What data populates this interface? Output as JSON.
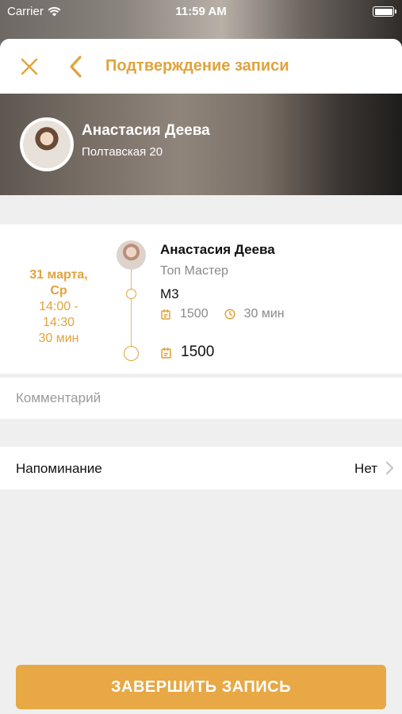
{
  "status_bar": {
    "carrier": "Carrier",
    "time": "11:59 AM"
  },
  "nav": {
    "title": "Подтверждение записи"
  },
  "salon": {
    "name": "Анастасия Деева",
    "address": "Полтавская 20"
  },
  "appointment": {
    "date_line1": "31 марта,",
    "date_line2": "Ср",
    "time_line1": "14:00 -",
    "time_line2": "14:30",
    "duration": "30 мин",
    "master_name": "Анастасия Деева",
    "master_role": "Топ Мастер",
    "service_name": "М3",
    "service_price": "1500",
    "service_duration": "30 мин",
    "total_price": "1500"
  },
  "comment": {
    "placeholder": "Комментарий"
  },
  "reminder": {
    "label": "Напоминание",
    "value": "Нет"
  },
  "actions": {
    "finish_label": "ЗАВЕРШИТЬ ЗАПИСЬ"
  },
  "colors": {
    "accent": "#e0a33c",
    "button": "#e7a845",
    "background": "#efefef"
  }
}
